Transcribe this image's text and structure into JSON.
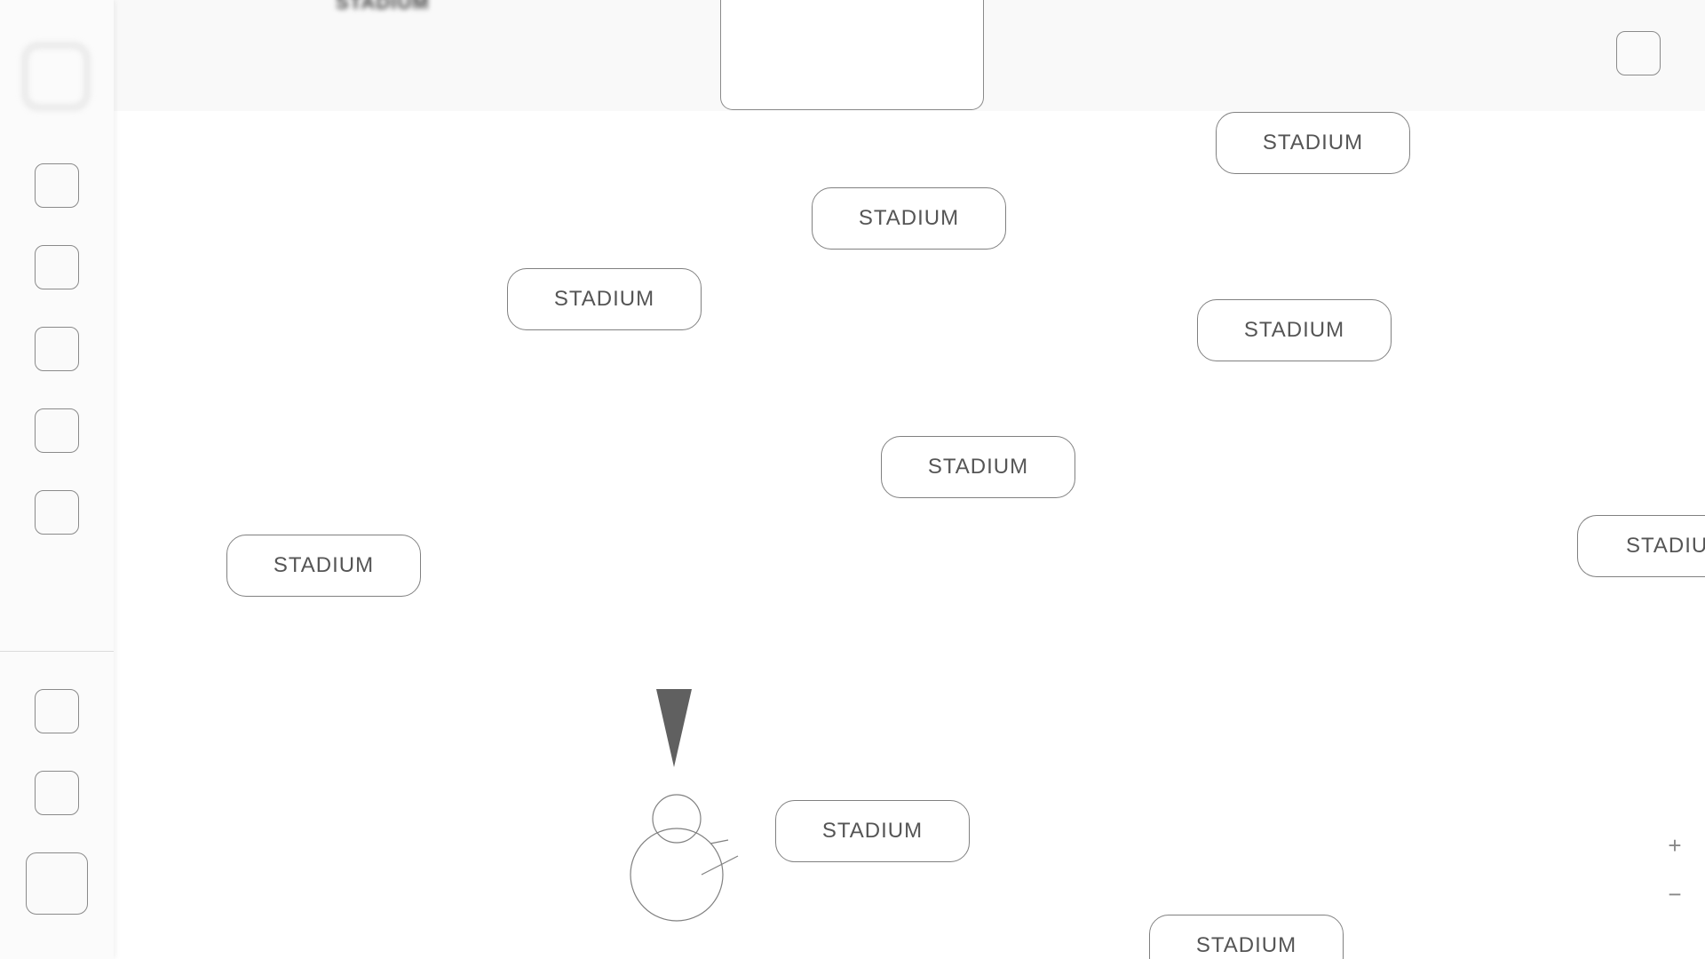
{
  "top_bar": {
    "title_blurred": "STADIUM"
  },
  "map": {
    "markers": [
      {
        "label": "STADIUM"
      },
      {
        "label": "STADIUM"
      },
      {
        "label": "STADIUM"
      },
      {
        "label": "STADIUM"
      },
      {
        "label": "STADIUM"
      },
      {
        "label": "STADIUM"
      },
      {
        "label": "STADIUM"
      },
      {
        "label": "STADIUM"
      },
      {
        "label": "STADIUM"
      }
    ],
    "clipped_marker_label": "STADIU"
  },
  "zoom": {
    "in_label": "+",
    "out_label": "−"
  },
  "icons": {
    "player": "player-avatar-icon",
    "direction": "direction-cone-icon"
  },
  "colors": {
    "background": "#ffffff",
    "topbar": "#f9f9f9",
    "border": "#808080",
    "text": "#555555",
    "cone": "#606060"
  }
}
